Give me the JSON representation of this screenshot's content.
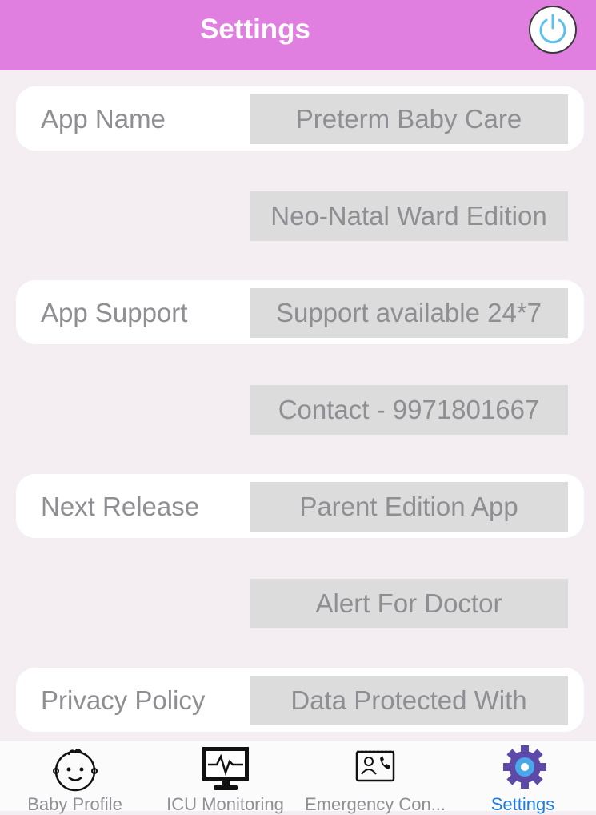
{
  "header": {
    "title": "Settings",
    "power_icon": "power-icon"
  },
  "rows": [
    {
      "label": "App Name",
      "value": "Preterm Baby Care"
    },
    {
      "label": "",
      "value": "Neo-Natal Ward Edition"
    },
    {
      "label": "App Support",
      "value": "Support available 24*7"
    },
    {
      "label": "",
      "value": "Contact - 9971801667"
    },
    {
      "label": "Next Release",
      "value": "Parent Edition App"
    },
    {
      "label": "",
      "value": "Alert For Doctor"
    },
    {
      "label": "Privacy Policy",
      "value": "Data Protected With"
    }
  ],
  "tabs": [
    {
      "label": "Baby Profile",
      "icon": "baby-face-icon",
      "active": false
    },
    {
      "label": "ICU Monitoring",
      "icon": "heart-monitor-icon",
      "active": false
    },
    {
      "label": "Emergency Con...",
      "icon": "contact-card-icon",
      "active": false
    },
    {
      "label": "Settings",
      "icon": "gear-icon",
      "active": true
    }
  ],
  "colors": {
    "header": "#e07fdf",
    "active_tab": "#1a7fe0",
    "power_ring": "#5bc0f0"
  }
}
